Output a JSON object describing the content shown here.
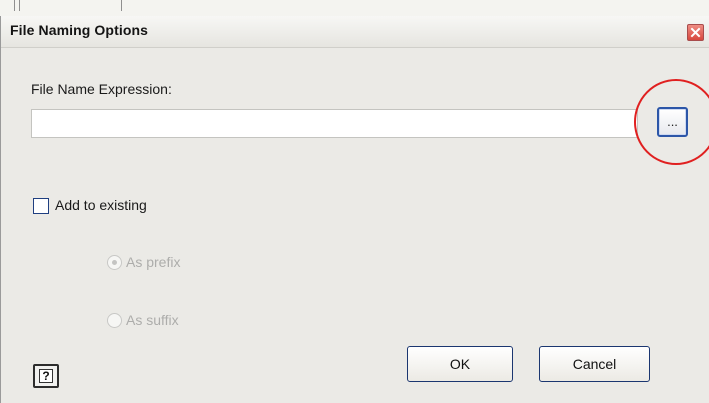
{
  "dialog": {
    "title": "File Naming Options",
    "close_icon": "close-icon"
  },
  "expression": {
    "label": "File Name Expression:",
    "value": "",
    "browse_label": "..."
  },
  "add_to_existing": {
    "label": "Add to existing",
    "checked": false
  },
  "position_options": [
    {
      "label": "As prefix",
      "selected": true,
      "enabled": false
    },
    {
      "label": "As suffix",
      "selected": false,
      "enabled": false
    }
  ],
  "buttons": {
    "help_glyph": "?",
    "ok_label": "OK",
    "cancel_label": "Cancel"
  },
  "colors": {
    "highlight_circle": "#e02020",
    "dialog_background": "#ebeae6",
    "button_border": "#1b3670"
  }
}
